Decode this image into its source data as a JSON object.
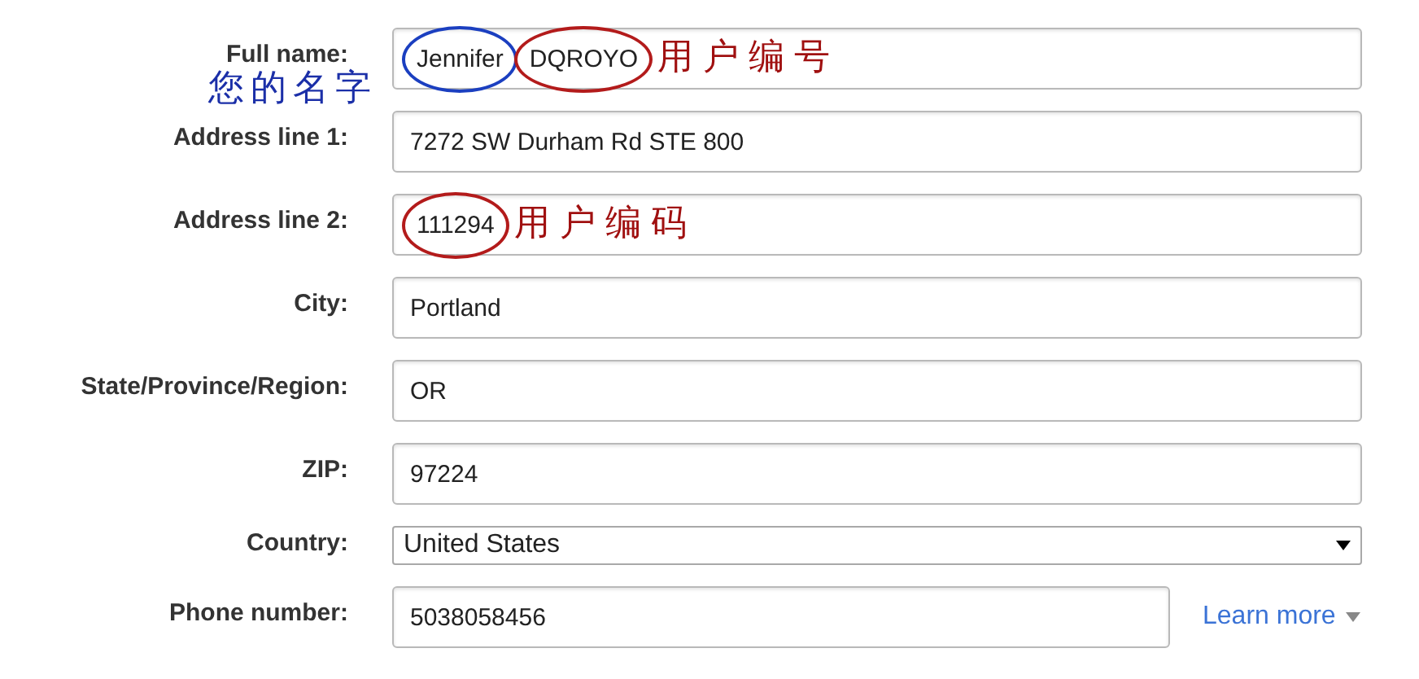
{
  "fields": [
    {
      "label": "Full name:",
      "kind": "text",
      "parts": [
        {
          "text": "Jennifer",
          "color": "#1b3fc0"
        },
        {
          "text": "DQROYO",
          "color": "#b31b1b"
        }
      ],
      "label_note": {
        "text": "您的名字",
        "color": "#1b2fa8"
      },
      "value_note": {
        "text": "用户编号",
        "color": "#a01010"
      }
    },
    {
      "label": "Address line 1:",
      "kind": "text",
      "parts": [
        {
          "text": "7272 SW Durham Rd STE 800"
        }
      ]
    },
    {
      "label": "Address line 2:",
      "kind": "text",
      "parts": [
        {
          "text": "111294",
          "color": "#b31b1b"
        }
      ],
      "value_note": {
        "text": "用户编码",
        "color": "#a01010"
      }
    },
    {
      "label": "City:",
      "kind": "text",
      "parts": [
        {
          "text": "Portland"
        }
      ]
    },
    {
      "label": "State/Province/Region:",
      "kind": "text",
      "parts": [
        {
          "text": "OR"
        }
      ]
    },
    {
      "label": "ZIP:",
      "kind": "text",
      "parts": [
        {
          "text": "97224"
        }
      ]
    },
    {
      "label": "Country:",
      "kind": "select",
      "parts": [
        {
          "text": "United States"
        }
      ]
    },
    {
      "label": "Phone number:",
      "kind": "text",
      "parts": [
        {
          "text": "5038058456"
        }
      ],
      "link": "Learn more"
    }
  ]
}
